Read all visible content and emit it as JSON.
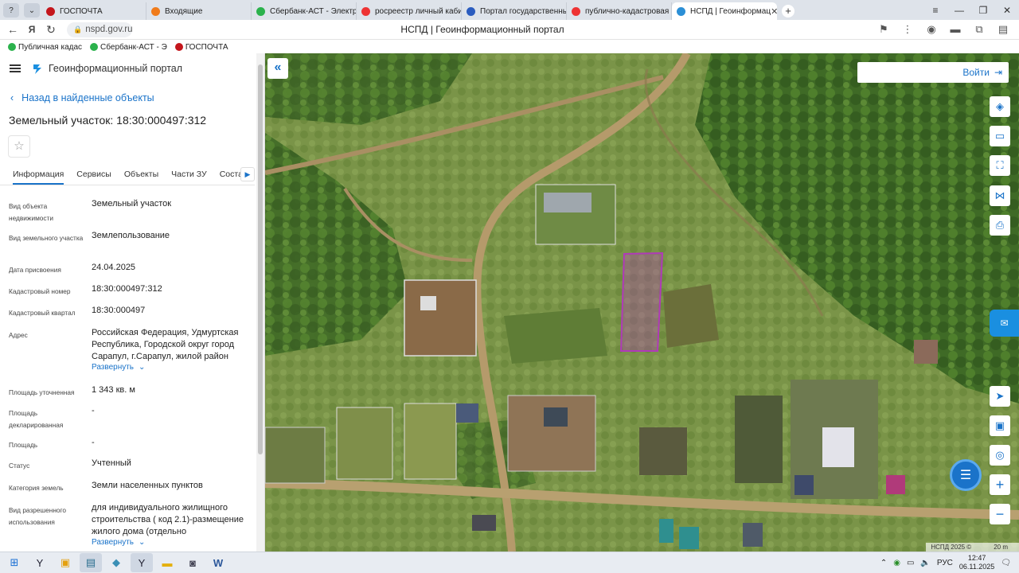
{
  "browser": {
    "tabs": [
      {
        "label": "ГОСПОЧТА",
        "fav": "#c4161c",
        "active": false
      },
      {
        "label": "Входящие",
        "fav": "#f07b1a",
        "active": false
      },
      {
        "label": "Сбербанк-АСТ - Электро",
        "fav": "#2bb24c",
        "active": false
      },
      {
        "label": "росреестр личный кабин",
        "fav": "#e33",
        "active": false
      },
      {
        "label": "Портал государственны",
        "fav": "#2b5cbf",
        "active": false
      },
      {
        "label": "публично-кадастровая к",
        "fav": "#e33",
        "active": false
      },
      {
        "label": "НСПД | Геоинформац",
        "fav": "#2b8fd6",
        "active": true
      }
    ],
    "url": "nspd.gov.ru",
    "page_title": "НСПД | Геоинформационный портал",
    "bookmarks": [
      {
        "label": "Публичная кадас",
        "color": "#2bb24c"
      },
      {
        "label": "Сбербанк-АСТ - Э",
        "color": "#2bb24c"
      },
      {
        "label": "ГОСПОЧТА",
        "color": "#c4161c"
      }
    ]
  },
  "panel": {
    "brand": "Геоинформационный портал",
    "back_label": "Назад в найденные объекты",
    "title": "Земельный участок: 18:30:000497:312",
    "tabs": [
      "Информация",
      "Сервисы",
      "Объекты",
      "Части ЗУ",
      "Соста"
    ],
    "expand_label": "Развернуть",
    "fields": [
      {
        "k": "Вид объекта недвижимости",
        "v": "Земельный участок"
      },
      {
        "k": "Вид земельного участка",
        "v": "Землепользование"
      },
      {
        "k": "Дата присвоения",
        "v": "24.04.2025"
      },
      {
        "k": "Кадастровый номер",
        "v": "18:30:000497:312"
      },
      {
        "k": "Кадастровый квартал",
        "v": "18:30:000497"
      },
      {
        "k": "Адрес",
        "v": "Российская Федерация, Удмуртская Республика, Городской округ город Сарапул, г.Сарапул, жилой район"
      },
      {
        "k": "Площадь уточненная",
        "v": "1 343 кв. м"
      },
      {
        "k": "Площадь декларированная",
        "v": "-"
      },
      {
        "k": "Площадь",
        "v": "-"
      },
      {
        "k": "Статус",
        "v": "Учтенный"
      },
      {
        "k": "Категория земель",
        "v": "Земли населенных пунктов"
      },
      {
        "k": "Вид разрешенного использования",
        "v": "для индивидуального жилищного строительства ( код 2.1)-размещение жилого дома (отдельно"
      }
    ]
  },
  "map": {
    "login_label": "Войти",
    "copyright": "НСПД 2025 ©",
    "scale": "20 m"
  },
  "taskbar": {
    "lang": "РУС",
    "time": "12:47",
    "date": "06.11.2025"
  },
  "colors": {
    "accent": "#1a73c9",
    "parcel": "#b03ab8"
  }
}
